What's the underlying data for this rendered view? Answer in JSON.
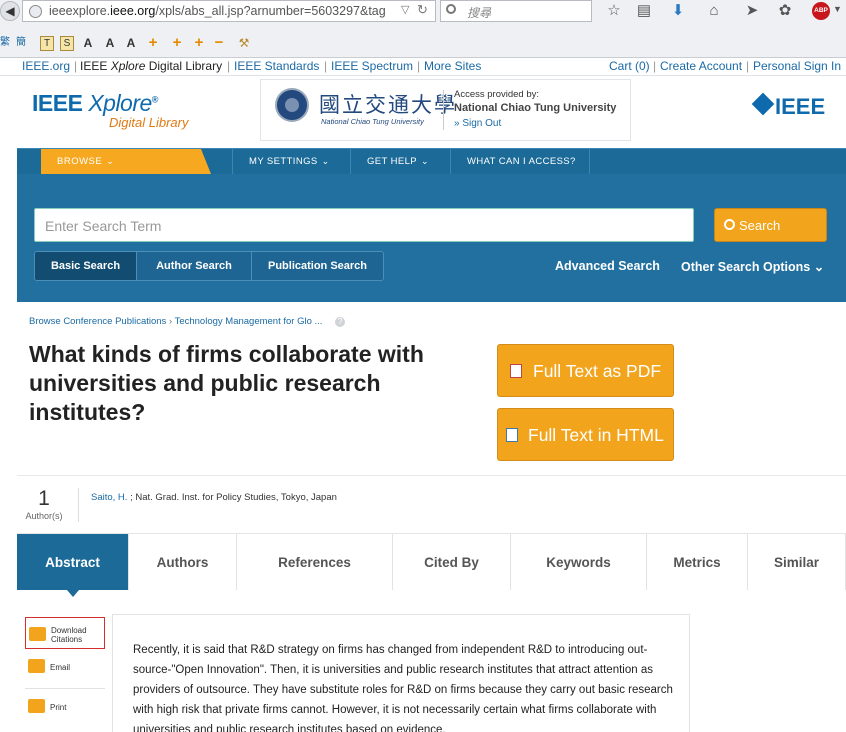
{
  "browser": {
    "url_prefix": "ieeexplore.",
    "url_domain": "ieee.org",
    "url_suffix": "/xpls/abs_all.jsp?arnumber=5603297&tag",
    "search_placeholder": "搜尋"
  },
  "toplinks": {
    "ieee_org": "IEEE.org",
    "ieee_xplore_a": "IEEE ",
    "ieee_xplore_b": "Xplore",
    "ieee_xplore_c": " Digital Library",
    "standards": "IEEE Standards",
    "spectrum": "IEEE Spectrum",
    "more": "More Sites",
    "cart": "Cart (0)",
    "create": "Create Account",
    "signin": "Personal Sign In"
  },
  "header": {
    "logo_a": "IEEE ",
    "logo_b": "Xplore",
    "logo_reg": "®",
    "logo_sub": "Digital Library",
    "univ_cn": "國立交通大學",
    "univ_en": "National Chiao Tung University",
    "access_label": "Access provided by:",
    "access_name": "National Chiao Tung University",
    "signout": "» Sign Out",
    "ieee_right": "IEEE"
  },
  "nav": {
    "browse": "BROWSE",
    "settings": "MY SETTINGS",
    "help": "GET HELP",
    "access": "WHAT CAN I ACCESS?"
  },
  "search": {
    "placeholder": "Enter Search Term",
    "button": "Search",
    "tabs": [
      "Basic Search",
      "Author Search",
      "Publication Search"
    ],
    "advanced": "Advanced Search",
    "other": "Other Search Options"
  },
  "article": {
    "crumb_1": "Browse Conference Publications",
    "crumb_2": "Technology Management for Glo ...",
    "title": "What kinds of firms collaborate with universities and public research institutes?",
    "pdf_button": "Full Text as PDF",
    "html_button": "Full Text in HTML",
    "author_count": "1",
    "author_count_label": "Author(s)",
    "author_name": "Saito, H.",
    "author_affil": " ; Nat. Grad. Inst. for Policy Studies, Tokyo, Japan"
  },
  "tabs": [
    "Abstract",
    "Authors",
    "References",
    "Cited By",
    "Keywords",
    "Metrics",
    "Similar"
  ],
  "sidebar": {
    "download": [
      "Download",
      "Citations"
    ],
    "email": "Email",
    "print": "Print"
  },
  "abstract_text": "Recently, it is said that R&D strategy on firms has changed from independent R&D to introducing out-source-\"Open Innovation\". Then, it is universities and public research institutes that attract attention as providers of outsource. They have substitute roles for R&D on firms because they carry out basic research with high risk that private firms cannot. However, it is not necessarily certain what firms collaborate with universities and public research institutes based on evidence.",
  "colors": {
    "brand_blue": "#1c6a97",
    "accent_orange": "#f2a41c",
    "link_blue": "#1b6aa5"
  }
}
